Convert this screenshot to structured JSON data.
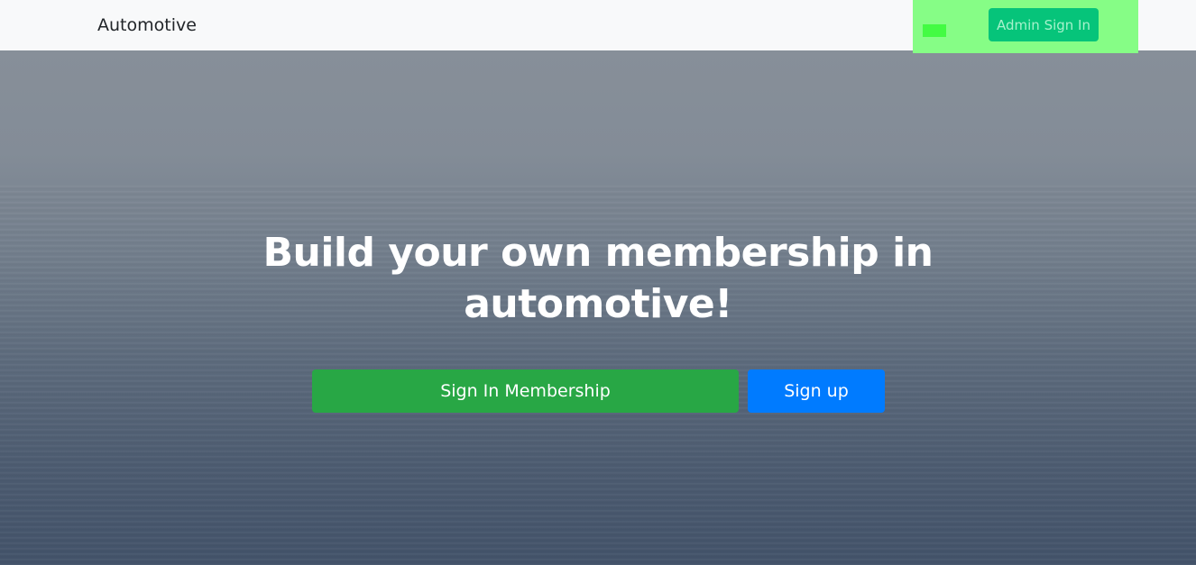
{
  "navbar": {
    "brand": "Automotive",
    "admin_sign_in_label": "Admin Sign In"
  },
  "hero": {
    "headline": "Build your own membership in automotive!",
    "sign_in_label": "Sign In Membership",
    "sign_up_label": "Sign up"
  },
  "colors": {
    "navbar_bg": "#f8f9fa",
    "highlight": "#86fd86",
    "admin_button": "#06c47a",
    "sign_in_button": "#28a745",
    "sign_up_button": "#007bff"
  }
}
